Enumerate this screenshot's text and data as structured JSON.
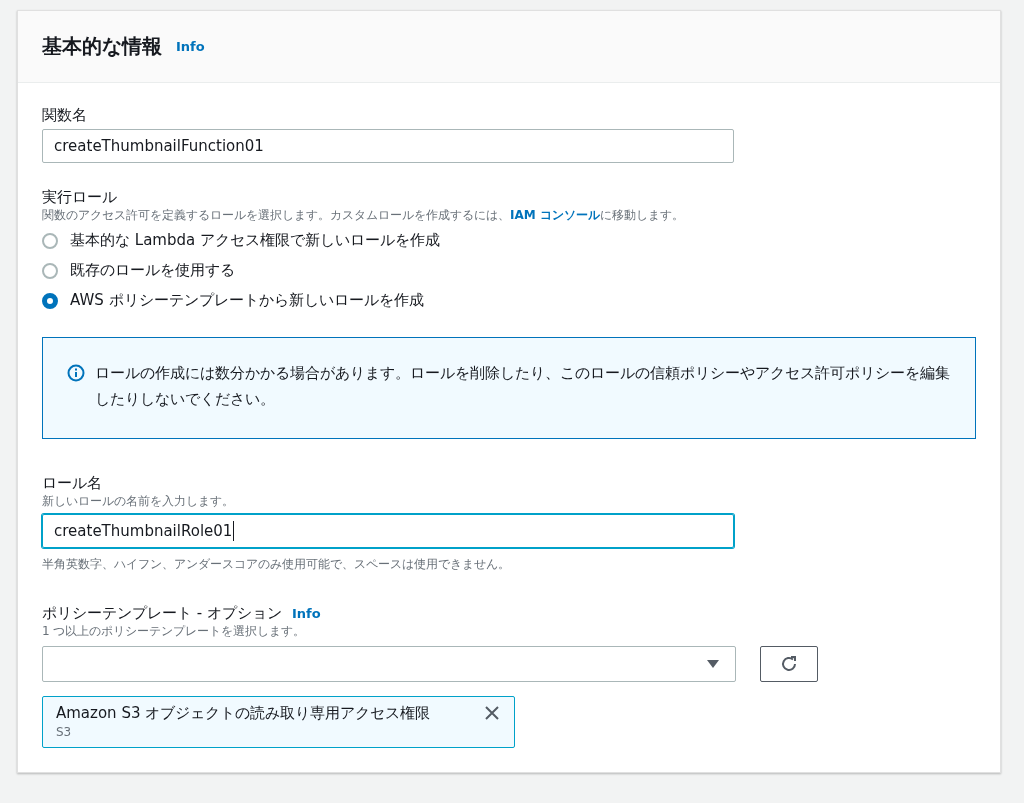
{
  "panel": {
    "title": "基本的な情報",
    "info_link": "Info"
  },
  "function_name": {
    "label": "関数名",
    "value": "createThumbnailFunction01",
    "focused": false
  },
  "execution_role": {
    "label": "実行ロール",
    "description": {
      "before": "関数のアクセス許可を定義するロールを選択します。カスタムロールを作成するには、",
      "link": "IAM コンソール",
      "after": "に移動します。"
    },
    "options": [
      {
        "label": "基本的な Lambda アクセス権限で新しいロールを作成",
        "selected": false
      },
      {
        "label": "既存のロールを使用する",
        "selected": false
      },
      {
        "label": "AWS ポリシーテンプレートから新しいロールを作成",
        "selected": true
      }
    ]
  },
  "alert": {
    "text": "ロールの作成には数分かかる場合があります。ロールを削除したり、このロールの信頼ポリシーやアクセス許可ポリシーを編集したりしないでください。"
  },
  "role_name": {
    "label": "ロール名",
    "description": "新しいロールの名前を入力します。",
    "value": "createThumbnailRole01",
    "focused": true,
    "constraint": "半角英数字、ハイフン、アンダースコアのみ使用可能で、スペースは使用できません。"
  },
  "policy_templates": {
    "label": "ポリシーテンプレート - オプション",
    "info_link": "Info",
    "description": "1 つ以上のポリシーテンプレートを選択します。",
    "selected_tokens": [
      {
        "title": "Amazon S3 オブジェクトの読み取り専用アクセス権限",
        "subtitle": "S3"
      }
    ]
  }
}
